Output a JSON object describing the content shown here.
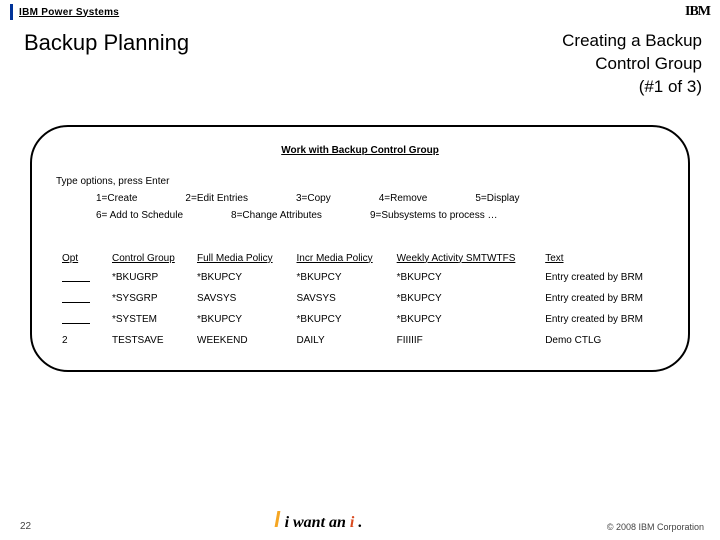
{
  "topbar": {
    "product": "IBM Power Systems",
    "logo": "IBM"
  },
  "header": {
    "title": "Backup Planning",
    "subtitle_l1": "Creating a Backup",
    "subtitle_l2": "Control Group",
    "subtitle_l3": "(#1 of 3)"
  },
  "panel": {
    "title": "Work with Backup Control Group",
    "prompt": "Type options, press Enter",
    "opts1": {
      "a": "1=Create",
      "b": "2=Edit Entries",
      "c": "3=Copy",
      "d": "4=Remove",
      "e": "5=Display"
    },
    "opts2": {
      "a": "6= Add to Schedule",
      "b": "8=Change Attributes",
      "c": "9=Subsystems to process …"
    },
    "cols": {
      "opt": "Opt",
      "cg": "Control Group",
      "fmp": "Full Media Policy",
      "imp": "Incr Media Policy",
      "wk": "Weekly Activity SMTWTFS",
      "txt": "Text"
    },
    "rows": [
      {
        "opt": "",
        "cg": "*BKUGRP",
        "fmp": "*BKUPCY",
        "imp": "*BKUPCY",
        "wk": "*BKUPCY",
        "txt": "Entry created by BRM"
      },
      {
        "opt": "",
        "cg": "*SYSGRP",
        "fmp": "SAVSYS",
        "imp": "SAVSYS",
        "wk": "*BKUPCY",
        "txt": "Entry created by BRM"
      },
      {
        "opt": "",
        "cg": "*SYSTEM",
        "fmp": "*BKUPCY",
        "imp": "*BKUPCY",
        "wk": "*BKUPCY",
        "txt": "Entry created by BRM"
      },
      {
        "opt": "2",
        "cg": "TESTSAVE",
        "fmp": "WEEKEND",
        "imp": "DAILY",
        "wk": "FIIIIIF",
        "txt": "Demo CTLG"
      }
    ]
  },
  "footer": {
    "page": "22",
    "tag_a": "i want an",
    "tag_b": "i",
    "tag_c": ".",
    "copy": "© 2008 IBM Corporation"
  }
}
